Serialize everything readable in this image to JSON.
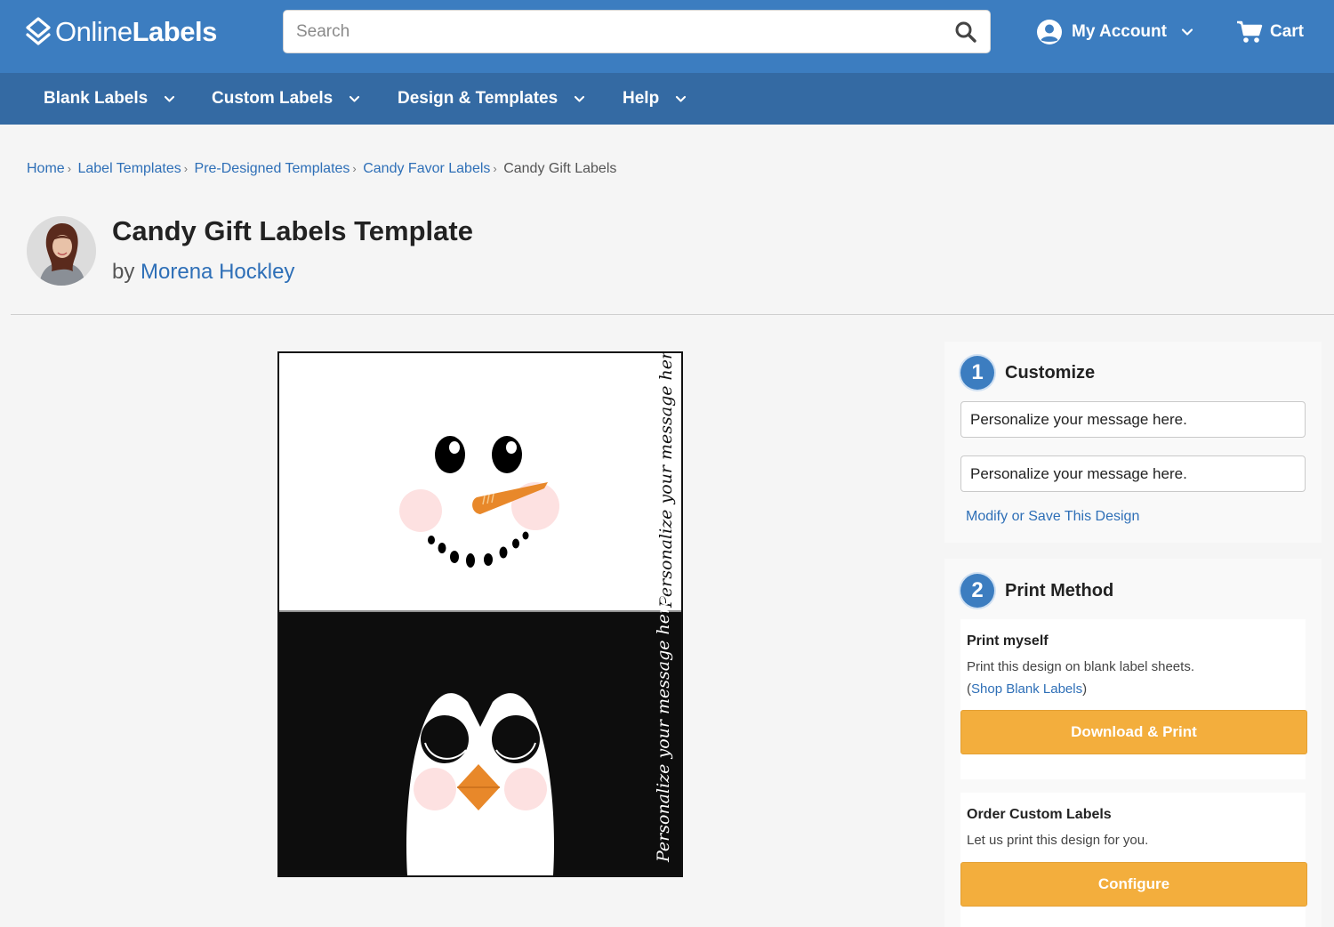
{
  "header": {
    "logo": {
      "part1": "Online",
      "part2": "Labels"
    },
    "search": {
      "placeholder": "Search"
    },
    "account_label": "My Account",
    "cart_label": "Cart"
  },
  "nav": {
    "items": [
      {
        "label": "Blank Labels"
      },
      {
        "label": "Custom Labels"
      },
      {
        "label": "Design & Templates"
      },
      {
        "label": "Help"
      }
    ]
  },
  "breadcrumb": {
    "items": [
      {
        "label": "Home"
      },
      {
        "label": "Label Templates"
      },
      {
        "label": "Pre-Designed Templates"
      },
      {
        "label": "Candy Favor Labels"
      }
    ],
    "current": "Candy Gift Labels",
    "separator": "›"
  },
  "page": {
    "title": "Candy Gift Labels Template",
    "by_prefix": "by",
    "author": "Morena Hockley"
  },
  "preview": {
    "message_top": "Personalize your message here.",
    "message_bottom": "Personalize your message here."
  },
  "customize": {
    "step_number": "1",
    "heading": "Customize",
    "field1_value": "Personalize your message here.",
    "field2_value": "Personalize your message here.",
    "modify_link": "Modify or Save This Design"
  },
  "print_method": {
    "step_number": "2",
    "heading": "Print Method",
    "print_myself": {
      "title": "Print myself",
      "description": "Print this design on blank label sheets.",
      "open_paren": "(",
      "shop_link": "Shop Blank Labels",
      "close_paren": ")",
      "button": "Download & Print"
    },
    "order_custom": {
      "title": "Order Custom Labels",
      "description": "Let us print this design for you.",
      "button": "Configure"
    }
  },
  "colors": {
    "topbar": "#3c7dc0",
    "navbar": "#346aa3",
    "link": "#2e6fb7",
    "button": "#f3ae3d"
  }
}
